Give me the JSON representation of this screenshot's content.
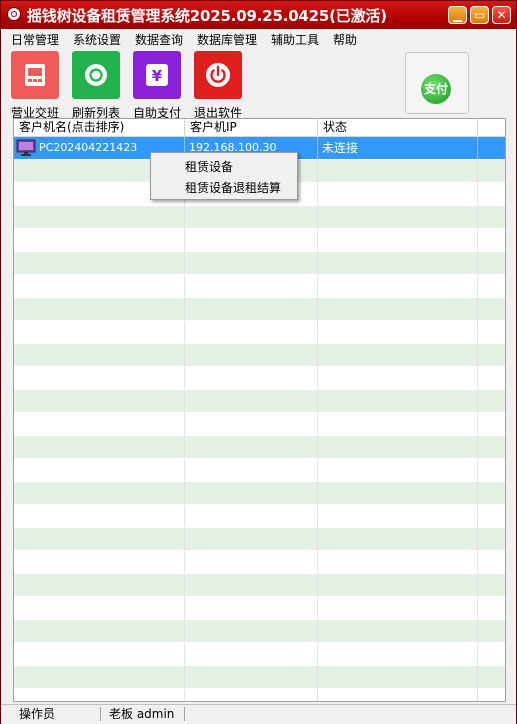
{
  "window": {
    "title": "摇钱树设备租赁管理系统2025.09.25.0425(已激活)",
    "controls": {
      "minimize": "▁",
      "maximize": "▭",
      "close": "✕"
    }
  },
  "menu": [
    {
      "label": "日常管理"
    },
    {
      "label": "系统设置"
    },
    {
      "label": "数据查询"
    },
    {
      "label": "数据库管理"
    },
    {
      "label": "辅助工具"
    },
    {
      "label": "帮助"
    }
  ],
  "toolbar": {
    "buttons": [
      {
        "label": "营业交班",
        "icon": "shift-handover-icon",
        "color": "#f05a5a"
      },
      {
        "label": "刷新列表",
        "icon": "refresh-icon",
        "color": "#22b14c"
      },
      {
        "label": "自助支付",
        "icon": "yuan-payment-icon",
        "color": "#8a22d8"
      },
      {
        "label": "退出软件",
        "icon": "power-icon",
        "color": "#e01e1e"
      }
    ],
    "pay_badge": "支付"
  },
  "list": {
    "columns": [
      "客户机名(点击排序)",
      "客户机IP",
      "状态"
    ],
    "rows": [
      {
        "name": "PC202404221423",
        "ip": "192.168.100.30",
        "status": "未连接",
        "selected": true
      }
    ],
    "selection_color": "#3399ff",
    "alt_row_color": "#e4f1e4"
  },
  "context_menu": {
    "items": [
      {
        "label": "租赁设备"
      },
      {
        "label": "租赁设备退租结算"
      }
    ]
  },
  "status_bar": {
    "role": "操作员",
    "user": "老板 admin"
  }
}
